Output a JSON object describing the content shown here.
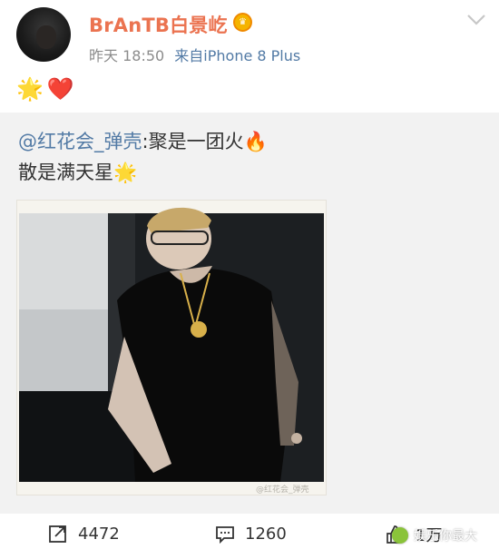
{
  "header": {
    "username": "BrAnTB白景屹",
    "time": "昨天 18:50",
    "source": "来自iPhone 8 Plus"
  },
  "post": {
    "reactions": [
      "🌟",
      "❤️"
    ]
  },
  "retweet": {
    "mention": "@红花会_弹壳",
    "line1_text": ":聚是一团火🔥",
    "line2_text": "散是满天星🌟",
    "photo_watermark": "@红花会_弹壳"
  },
  "toolbar": {
    "repost_count": "4472",
    "comment_count": "1260",
    "like_count": "1万"
  },
  "overlay": {
    "watermark_text": "娱乐你最大"
  },
  "colors": {
    "username": "#eb7350",
    "link": "#527aa5",
    "meta": "#8c8c8c",
    "retweet_bg": "#f2f2f2"
  },
  "icons": {
    "badge": "vip-badge-icon",
    "dropdown": "chevron-down-icon",
    "repost": "repost-icon",
    "comment": "comment-icon",
    "like": "thumbs-up-icon"
  }
}
